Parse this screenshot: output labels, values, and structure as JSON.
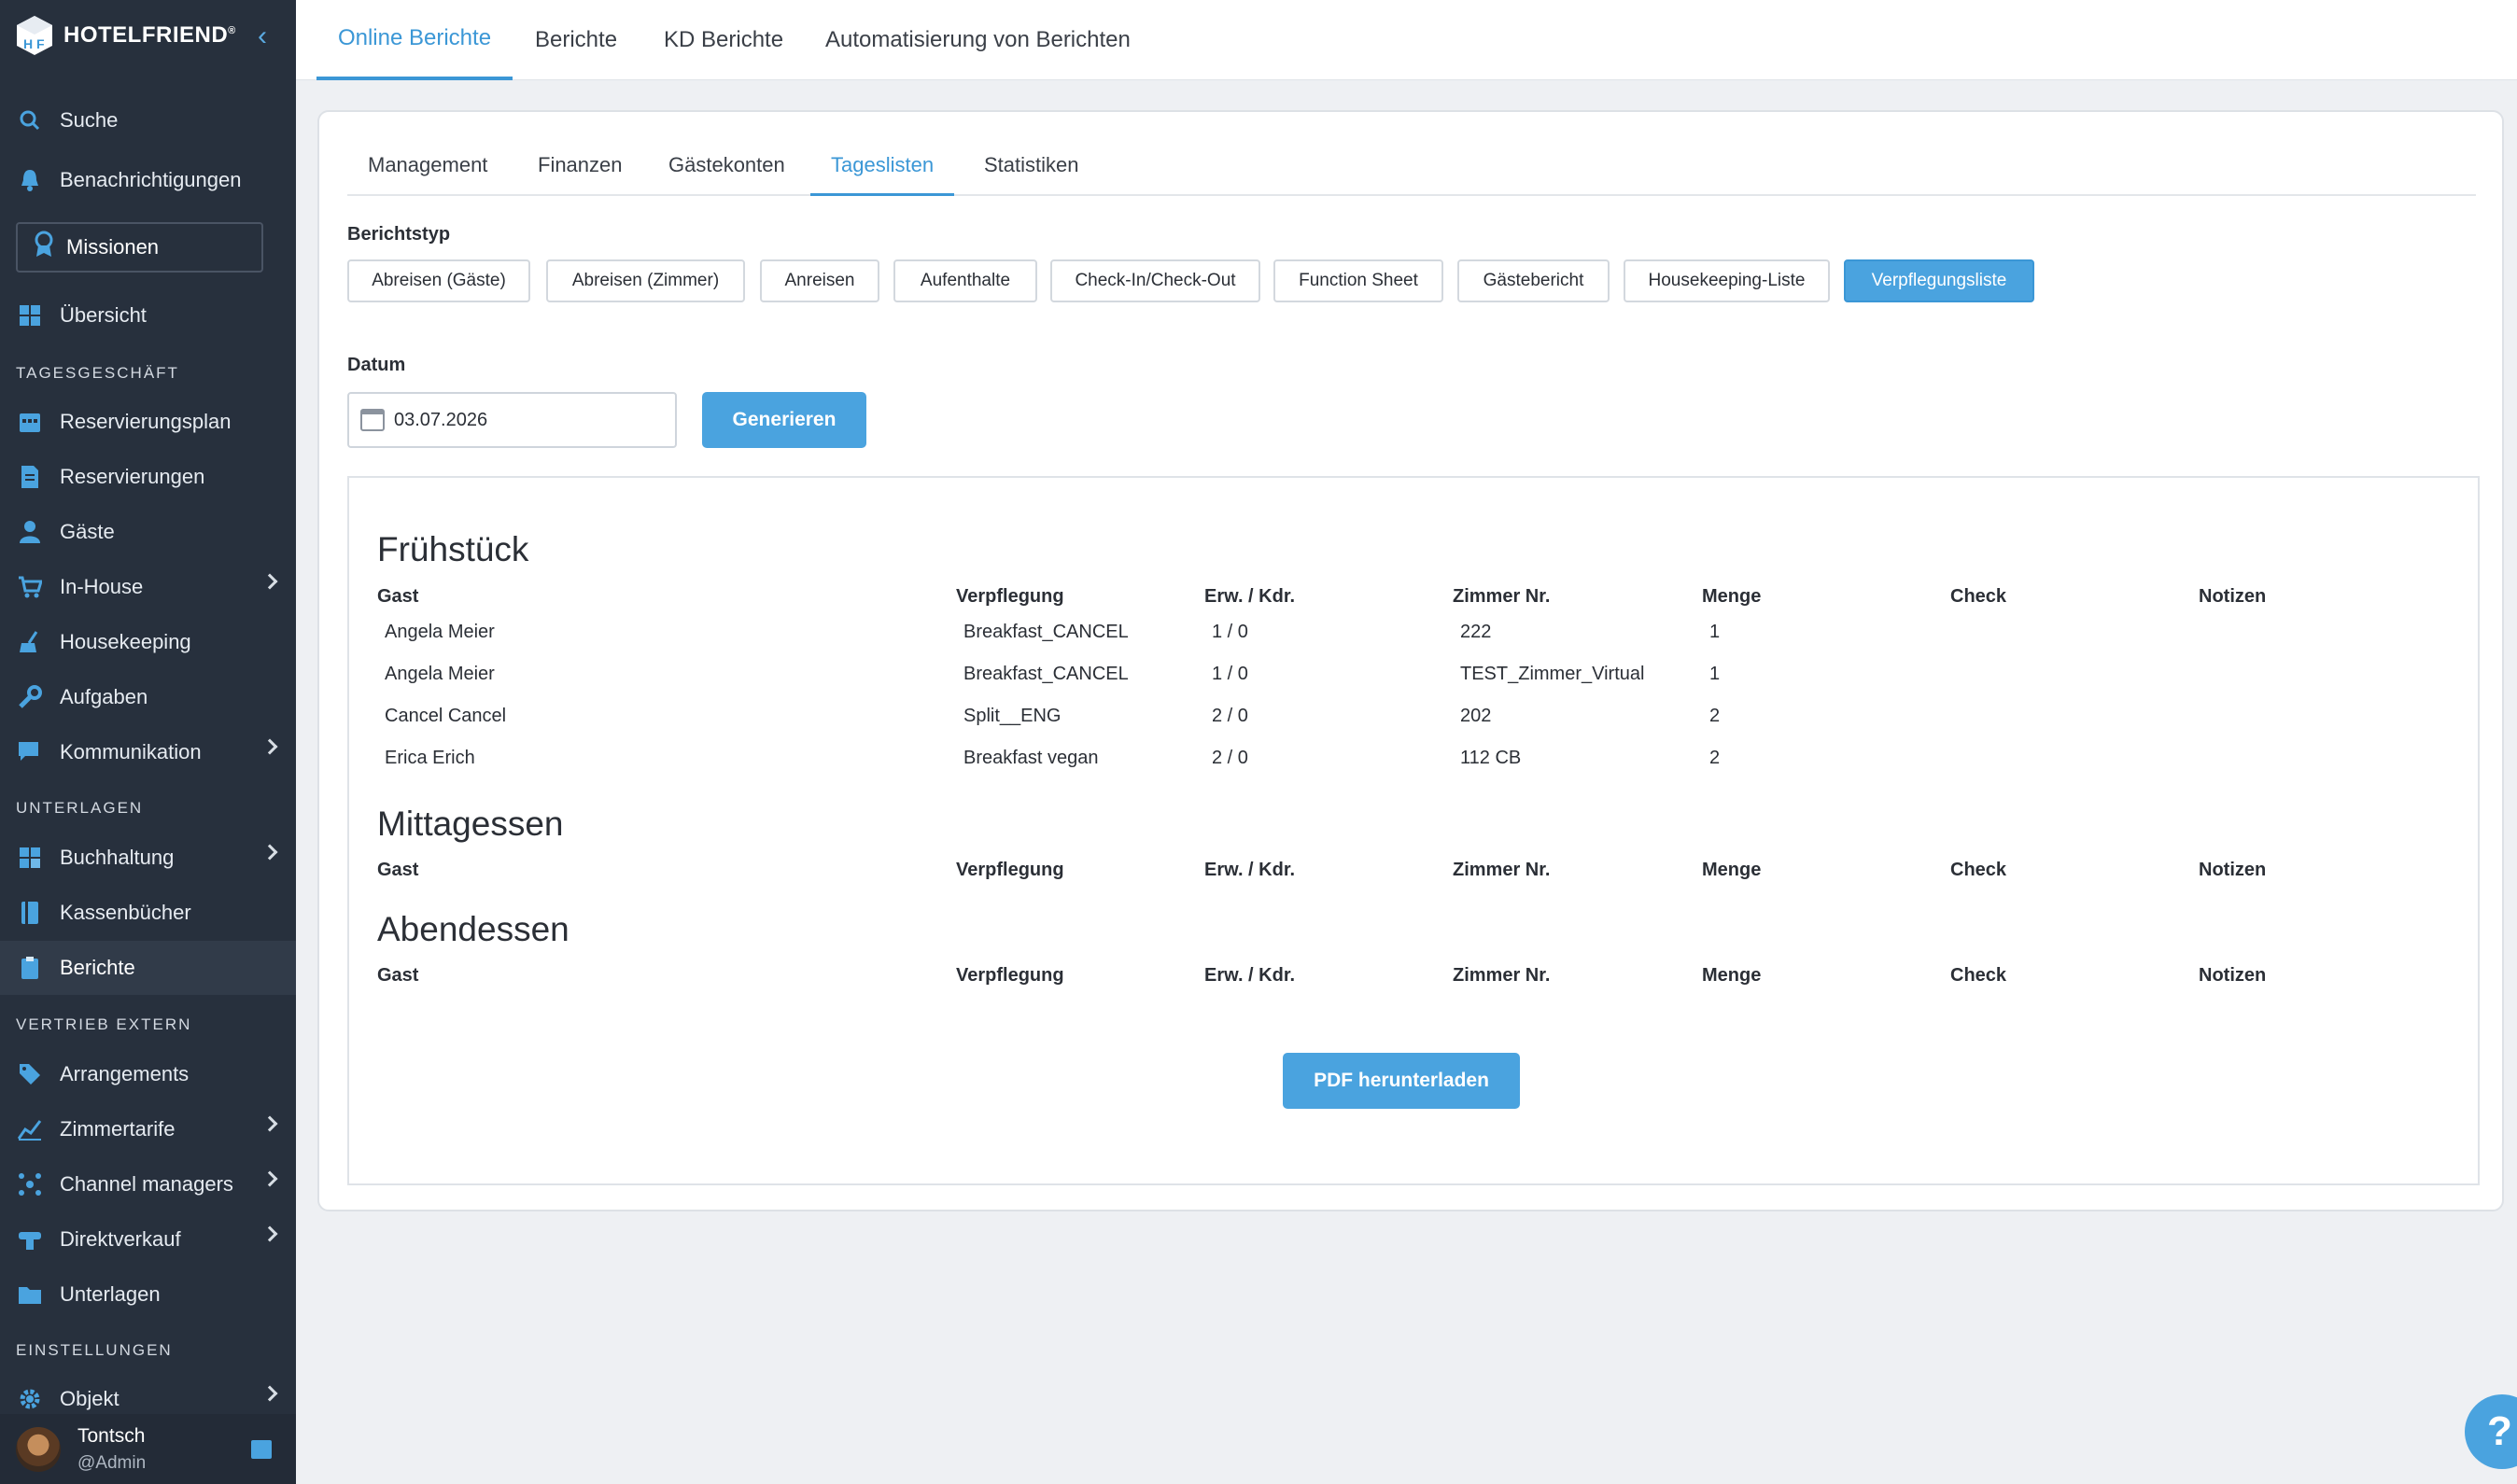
{
  "brand": {
    "name": "HOTELFRIEND",
    "mark": "®"
  },
  "sidebar": {
    "search": "Suche",
    "notifications": "Benachrichtigungen",
    "missions": "Missionen",
    "overview": "Übersicht",
    "sections": {
      "daily": "TAGESGESCHÄFT",
      "documents": "UNTERLAGEN",
      "sales": "VERTRIEB EXTERN",
      "settings": "EINSTELLUNGEN"
    },
    "daily_items": [
      "Reservierungsplan",
      "Reservierungen",
      "Gäste",
      "In-House",
      "Housekeeping",
      "Aufgaben",
      "Kommunikation"
    ],
    "doc_items": [
      "Buchhaltung",
      "Kassenbücher",
      "Berichte"
    ],
    "sales_items": [
      "Arrangements",
      "Zimmertarife",
      "Channel managers",
      "Direktverkauf",
      "Unterlagen"
    ],
    "settings_items": [
      "Objekt"
    ],
    "user": {
      "name": "Tontsch",
      "role": "@Admin"
    }
  },
  "top_tabs": [
    "Online Berichte",
    "Berichte",
    "KD Berichte",
    "Automatisierung von Berichten"
  ],
  "sub_tabs": [
    "Management",
    "Finanzen",
    "Gästekonten",
    "Tageslisten",
    "Statistiken"
  ],
  "report_type": {
    "label": "Berichtstyp",
    "options": [
      "Abreisen (Gäste)",
      "Abreisen (Zimmer)",
      "Anreisen",
      "Aufenthalte",
      "Check-In/Check-Out",
      "Function Sheet",
      "Gästebericht",
      "Housekeeping-Liste",
      "Verpflegungsliste"
    ],
    "selected": "Verpflegungsliste"
  },
  "date": {
    "label": "Datum",
    "value": "03.07.2026",
    "generate": "Generieren"
  },
  "columns": [
    "Gast",
    "Verpflegung",
    "Erw. / Kdr.",
    "Zimmer Nr.",
    "Menge",
    "Check",
    "Notizen"
  ],
  "meals": [
    {
      "title": "Frühstück",
      "rows": [
        [
          "Angela Meier",
          "Breakfast_CANCEL",
          "1 / 0",
          "222",
          "1"
        ],
        [
          "Angela Meier",
          "Breakfast_CANCEL",
          "1 / 0",
          "TEST_Zimmer_Virtual",
          "1"
        ],
        [
          "Cancel Cancel",
          "Split__ENG",
          "2 / 0",
          "202",
          "2"
        ],
        [
          "Erica Erich",
          "Breakfast vegan",
          "2 / 0",
          "112 CB",
          "2"
        ]
      ]
    },
    {
      "title": "Mittagessen",
      "rows": []
    },
    {
      "title": "Abendessen",
      "rows": []
    }
  ],
  "pdf_button": "PDF herunterladen",
  "help": "?"
}
